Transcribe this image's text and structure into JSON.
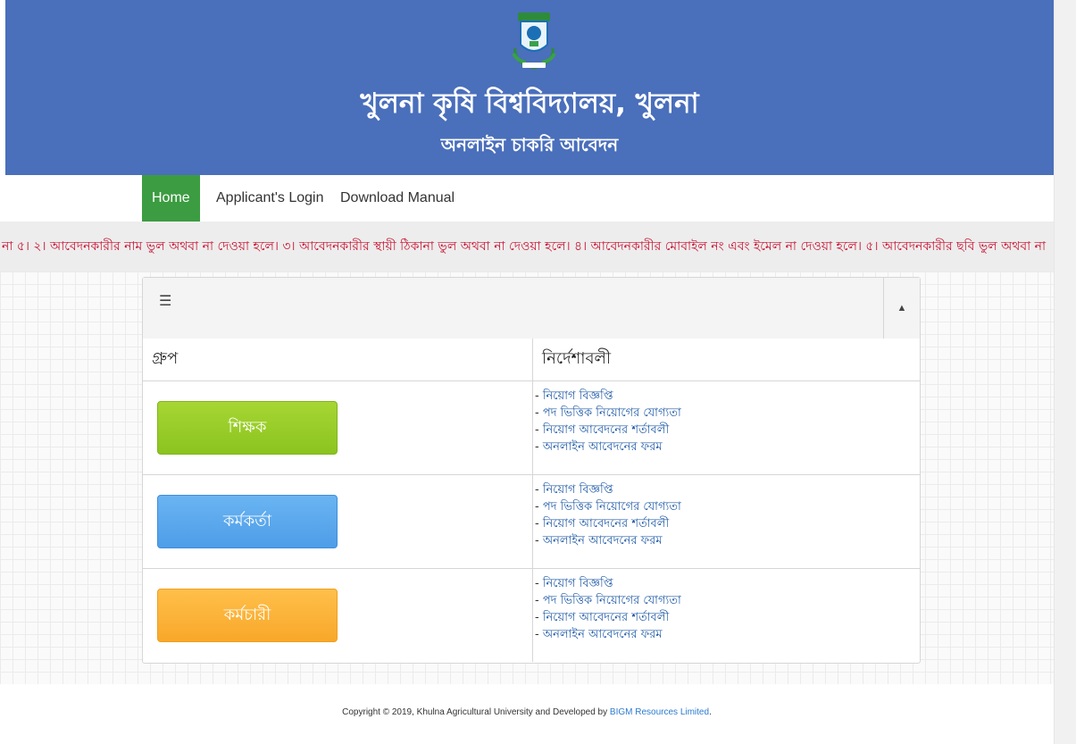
{
  "header": {
    "title": "খুলনা কৃষি বিশ্ববিদ্যালয়, খুলনা",
    "subtitle": "অনলাইন চাকরি আবেদন"
  },
  "nav": {
    "items": [
      {
        "label": "Home",
        "active": true
      },
      {
        "label": "Applicant's Login",
        "active": false
      },
      {
        "label": "Download Manual",
        "active": false
      }
    ]
  },
  "ticker": {
    "text": "না ৫। ২। আবেদনকারীর নাম ভুল অথবা না দেওয়া হলে। ৩। আবেদনকারীর স্থায়ী ঠিকানা ভুল অথবা না দেওয়া হলে। ৪। আবেদনকারীর মোবাইল নং এবং ইমেল না দেওয়া হলে। ৫। আবেদনকারীর ছবি ভুল অথবা না"
  },
  "panel": {
    "menu_icon": "list-icon",
    "collapse_icon": "caret-up-icon",
    "columns": [
      "গ্রুপ",
      "নির্দেশাবলী"
    ],
    "rows": [
      {
        "group_label": "শিক্ষক",
        "color": "#8cc41f",
        "links": [
          "নিয়োগ বিজ্ঞপ্তি",
          "পদ ভিত্তিক নিয়োগের যোগ্যতা",
          "নিয়োগ আবেদনের শর্তাবলী",
          "অনলাইন আবেদনের ফরম"
        ]
      },
      {
        "group_label": "কর্মকর্তা",
        "color": "#4e9de8",
        "links": [
          "নিয়োগ বিজ্ঞপ্তি",
          "পদ ভিত্তিক নিয়োগের যোগ্যতা",
          "নিয়োগ আবেদনের শর্তাবলী",
          "অনলাইন আবেদনের ফরম"
        ]
      },
      {
        "group_label": "কর্মচারী",
        "color": "#f8a82a",
        "links": [
          "নিয়োগ বিজ্ঞপ্তি",
          "পদ ভিত্তিক নিয়োগের যোগ্যতা",
          "নিয়োগ আবেদনের শর্তাবলী",
          "অনলাইন আবেদনের ফরম"
        ]
      }
    ]
  },
  "footer": {
    "text_before": "Copyright © 2019, Khulna Agricultural University and Developed by ",
    "link": "BIGM Resources Limited",
    "text_after": "."
  },
  "colors": {
    "header_bg": "#4a6fbb",
    "nav_active": "#3c9c41",
    "ticker_text": "#c8102e",
    "link": "#1f5aa6"
  }
}
